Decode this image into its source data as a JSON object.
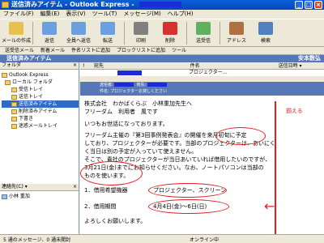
{
  "window": {
    "title": "送信済みアイテム - Outlook Express -",
    "buttons": {
      "min": "_",
      "max": "□",
      "close": "×"
    }
  },
  "menu": [
    "ファイル(F)",
    "編集(E)",
    "表示(V)",
    "ツール(T)",
    "メッセージ(M)",
    "ヘルプ(H)"
  ],
  "toolbar": {
    "items": [
      {
        "label": "メールの作成",
        "icon": "compose-icon",
        "color": "#e8c050"
      },
      {
        "label": "返信",
        "icon": "reply-icon",
        "color": "#6aa0e0"
      },
      {
        "label": "全員へ返信",
        "icon": "reply-all-icon",
        "color": "#6aa0e0"
      },
      {
        "label": "転送",
        "icon": "forward-icon",
        "color": "#6aa0e0"
      },
      {
        "label": "印刷",
        "icon": "print-icon",
        "color": "#808080"
      },
      {
        "label": "削除",
        "icon": "delete-icon",
        "color": "#d83030"
      },
      {
        "label": "送受信",
        "icon": "send-receive-icon",
        "color": "#60b060"
      },
      {
        "label": "アドレス",
        "icon": "address-book-icon",
        "color": "#b07040"
      },
      {
        "label": "検索",
        "icon": "find-icon",
        "color": "#5080c0"
      }
    ]
  },
  "linkbar": [
    "送受信メール",
    "新着メール",
    "件名リストに追加",
    "プロックリストに追加",
    "ツール"
  ],
  "folder": {
    "title": "送信済みアイテム",
    "user": "安本数弘"
  },
  "folders": {
    "header": "フォルダ",
    "items": [
      "Outlook Express",
      "ローカル フォルダ",
      "受信トレイ",
      "送信トレイ",
      "送信済みアイテム",
      "削除済みアイテム",
      "下書き",
      "迷惑メールトレイ"
    ]
  },
  "contacts": {
    "header": "連絡先(C) ▾",
    "item": "小林 重加"
  },
  "list": {
    "columns": [
      "!",
      "宛先",
      "件名",
      "送信日時 ▾"
    ],
    "row_subject": "プロジェクター…"
  },
  "preview": {
    "from": "送信者:",
    "to": "宛先:",
    "subject": "件名: プロジェクターお貸しください"
  },
  "message": {
    "lines": [
      "株式会社　わかばくらぶ　小林重加先生へ",
      "フリーダム　利用者　風です",
      "いつもお世話になっております。",
      "フリーダム主催の『第3回事例発表会』の開催を来月初旬に予定",
      "しており、プロジェクターが必要です。当部のプロジェクターは、あいにく",
      "く当日は別の予定が入っていて使えません。",
      "そこで、貴社のプロジェクターが当日あいていれば借用したいのですが、",
      "3月21日(金)までにお知らせください。なお、ノートパソコンは当部の",
      "ものを使います。",
      "1．借用希望機器",
      "2．借用期間",
      "よろしくお願いします。"
    ],
    "item1_value": "プロジェクター、スクリーン",
    "item2_value": "4月4日(金)～6日(日)"
  },
  "annotation": "揃える",
  "status": {
    "count": "5 通のメッセージ、0 通未開封",
    "online": "オンライン中"
  },
  "colors": {
    "accent": "#5877b8",
    "annotation": "#e02020",
    "title": "#0a5fd8"
  }
}
